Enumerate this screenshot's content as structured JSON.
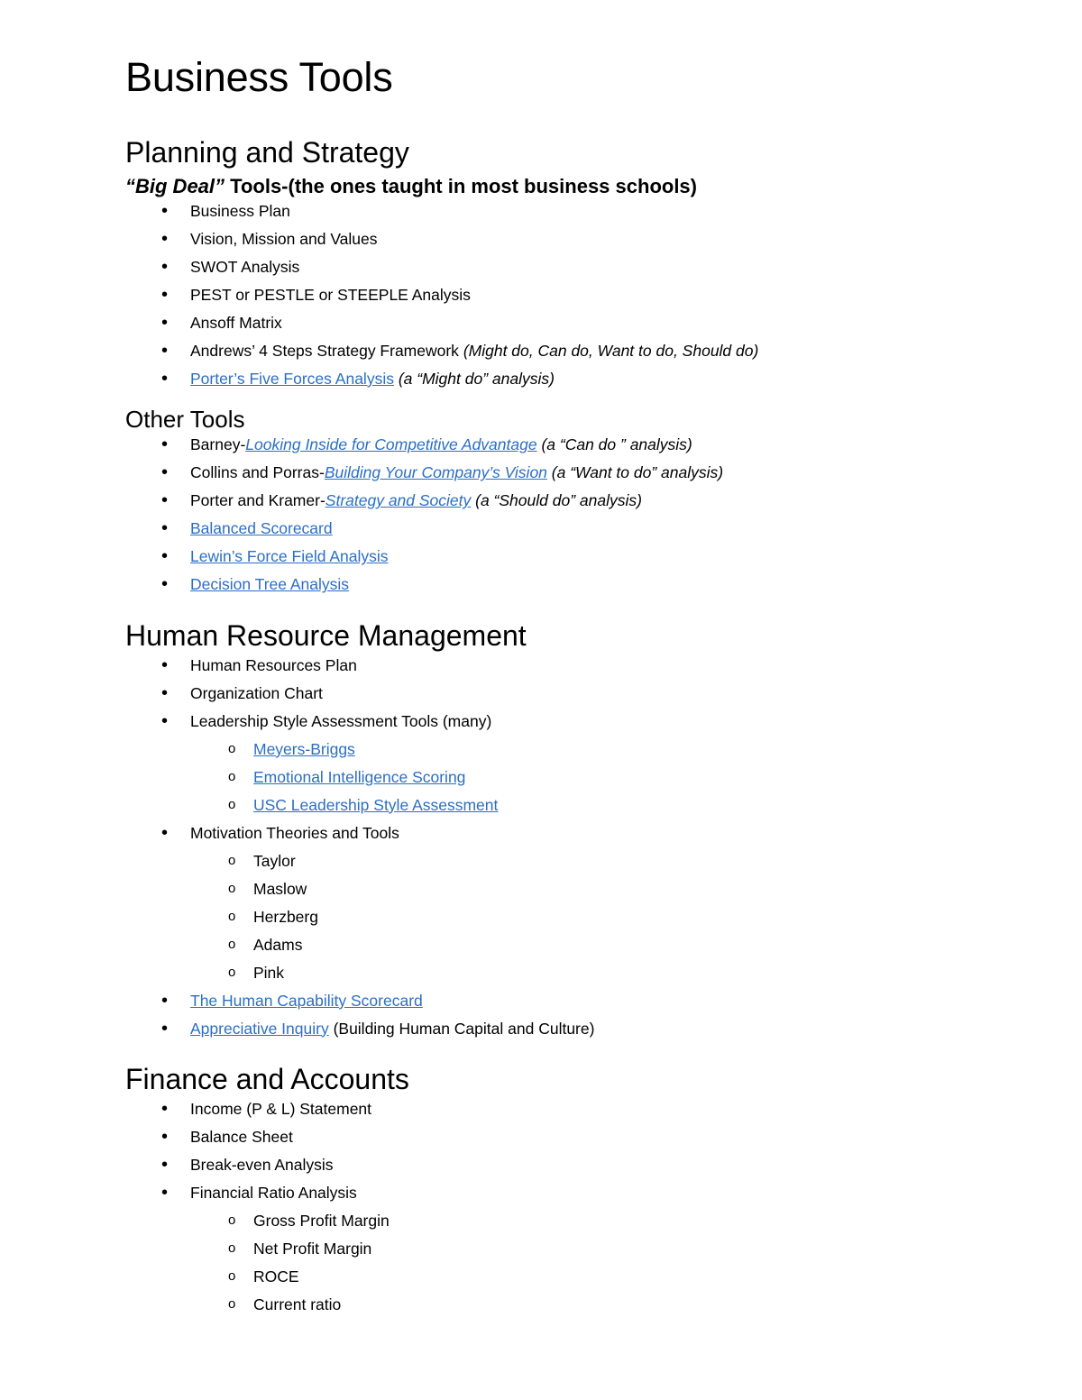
{
  "document": {
    "title": "Business Tools",
    "link_color": "#2B6FC4",
    "text_color": "#000000",
    "background_color": "#FFFFFF"
  },
  "sections": [
    {
      "id": "planning-and-strategy",
      "heading": "Planning and Strategy",
      "lead": {
        "emphasis": "“Big Deal”",
        "rest": " Tools-(the ones taught in most business schools)"
      },
      "items": [
        {
          "text": "Business Plan"
        },
        {
          "text": "Vision, Mission and Values"
        },
        {
          "text": "SWOT Analysis"
        },
        {
          "text": "PEST or PESTLE or STEEPLE Analysis"
        },
        {
          "text": "Ansoff Matrix"
        },
        {
          "prefix": "Andrews’ 4 Steps Strategy Framework ",
          "italic": "(Might do, Can do, Want to do, Should do)"
        },
        {
          "link": "Porter’s Five Forces Analysis",
          "suffix_italic": " (a “Might do” analysis)"
        }
      ],
      "subheading": "Other Tools",
      "other_items": [
        {
          "prefix": "Barney-",
          "link_italic": "Looking Inside for Competitive Advantage",
          "suffix_italic": " (a “Can do ” analysis)"
        },
        {
          "prefix": "Collins and Porras-",
          "link_italic": "Building Your Company’s Vision",
          "suffix_italic": " (a “Want to do” analysis)"
        },
        {
          "prefix": "Porter and Kramer-",
          "link_italic": "Strategy and Society",
          "suffix_italic": " (a “Should do” analysis)"
        },
        {
          "link": "Balanced Scorecard"
        },
        {
          "link": "Lewin’s Force Field Analysis"
        },
        {
          "link": "Decision Tree Analysis"
        }
      ]
    },
    {
      "id": "human-resource-management",
      "heading": "Human Resource Management",
      "items": [
        {
          "text": "Human Resources Plan"
        },
        {
          "text": "Organization Chart"
        },
        {
          "text": "Leadership Style Assessment Tools (many)"
        },
        {
          "text": "Motivation Theories and Tools"
        }
      ],
      "leadership_subitems": [
        {
          "link": "Meyers-Briggs"
        },
        {
          "link": "Emotional Intelligence Scoring"
        },
        {
          "link": "USC Leadership Style Assessment"
        }
      ],
      "motivation_subitems": [
        {
          "text": "Taylor"
        },
        {
          "text": "Maslow"
        },
        {
          "text": "Herzberg"
        },
        {
          "text": "Adams"
        },
        {
          "text": "Pink"
        }
      ],
      "tail_items": [
        {
          "link": "The Human Capability Scorecard"
        },
        {
          "link": "Appreciative Inquiry",
          "suffix": " (Building Human Capital and Culture)"
        }
      ]
    },
    {
      "id": "finance-and-accounts",
      "heading": "Finance and Accounts",
      "items": [
        {
          "text": "Income (P & L) Statement"
        },
        {
          "text": "Balance Sheet"
        },
        {
          "text": "Break-even Analysis"
        },
        {
          "text": "Financial Ratio Analysis"
        }
      ],
      "ratio_subitems": [
        {
          "text": "Gross Profit Margin"
        },
        {
          "text": "Net Profit Margin"
        },
        {
          "text": "ROCE"
        },
        {
          "text": "Current ratio"
        }
      ]
    }
  ]
}
